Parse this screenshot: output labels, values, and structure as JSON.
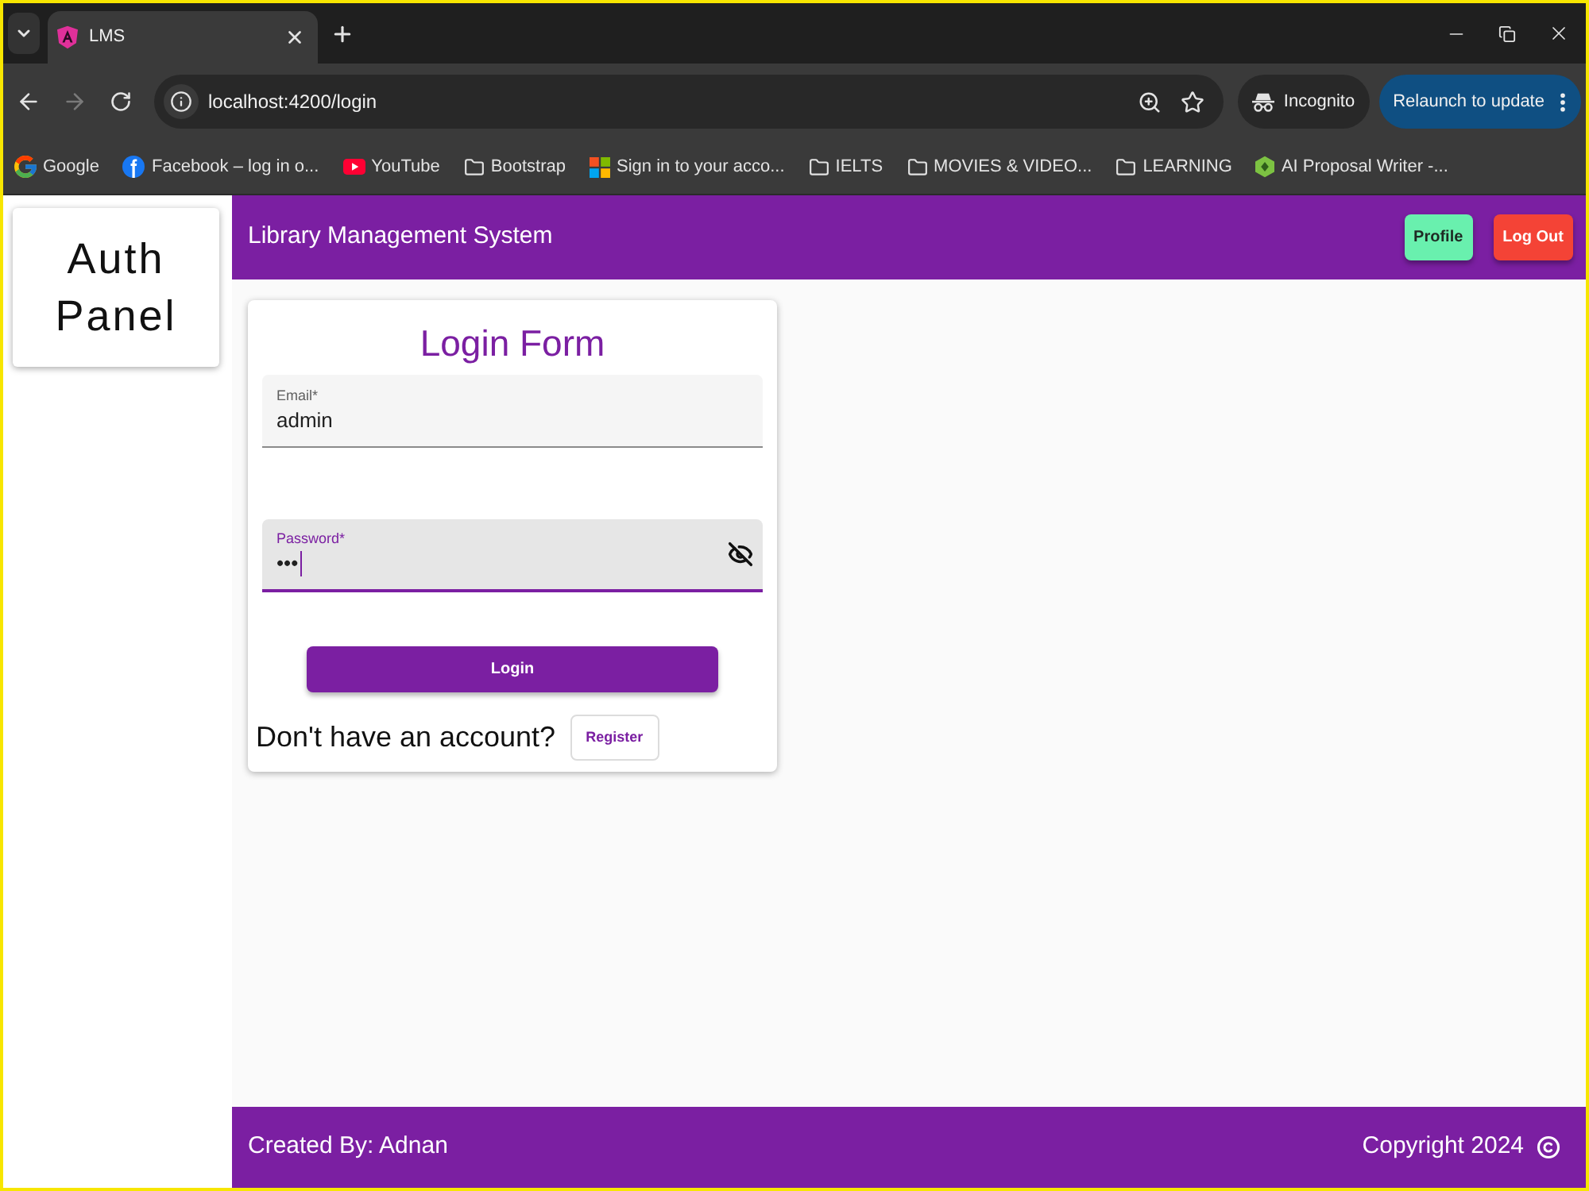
{
  "browser": {
    "tabs": [
      {
        "title": "LMS",
        "selected": true
      }
    ],
    "nav": {
      "back_disabled": false,
      "forward_disabled": true
    },
    "address": "localhost:4200/login",
    "profile_chip": "Incognito",
    "update_button": "Relaunch to update",
    "bookmarks": [
      {
        "label": "Google",
        "kind": "site"
      },
      {
        "label": "Facebook – log in o...",
        "kind": "site"
      },
      {
        "label": "YouTube",
        "kind": "site"
      },
      {
        "label": "Bootstrap",
        "kind": "folder"
      },
      {
        "label": "Sign in to your acco...",
        "kind": "site"
      },
      {
        "label": "IELTS",
        "kind": "folder"
      },
      {
        "label": "MOVIES & VIDEO...",
        "kind": "folder"
      },
      {
        "label": "LEARNING",
        "kind": "folder"
      },
      {
        "label": "AI Proposal Writer -...",
        "kind": "site"
      }
    ]
  },
  "sidebar": {
    "title": "Auth Panel"
  },
  "header": {
    "title": "Library Management System",
    "buttons": [
      {
        "label": "Profile",
        "kind": "accent"
      },
      {
        "label": "Log Out",
        "kind": "warn"
      }
    ]
  },
  "login_form": {
    "title": "Login Form",
    "fields": [
      {
        "label": "Email*",
        "value": "admin",
        "kind": "email",
        "focused": false
      },
      {
        "label": "Password*",
        "value": "•••",
        "kind": "password",
        "focused": true
      }
    ],
    "submit": "Login",
    "prompt": "Don't have an account?",
    "register": "Register"
  },
  "footer": {
    "credit": "Created By: Adnan",
    "copyright": "Copyright 2024"
  }
}
